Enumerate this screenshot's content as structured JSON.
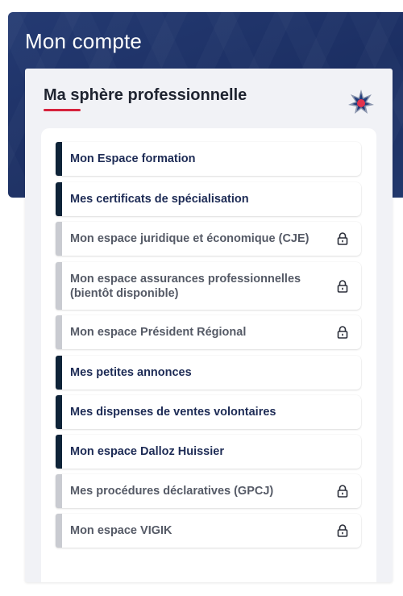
{
  "header": {
    "title": "Mon compte"
  },
  "card": {
    "title": "Ma sphère professionnelle",
    "emblem_icon": "compass-star-emblem",
    "accent_color": "#d6223c"
  },
  "items": [
    {
      "label": "Mon Espace formation",
      "locked": false
    },
    {
      "label": "Mes certificats de spécialisation",
      "locked": false
    },
    {
      "label": "Mon espace juridique et économique (CJE)",
      "locked": true
    },
    {
      "label": "Mon espace assurances professionnelles (bientôt disponible)",
      "locked": true
    },
    {
      "label": "Mon espace Président Régional",
      "locked": true
    },
    {
      "label": "Mes petites annonces",
      "locked": false
    },
    {
      "label": "Mes dispenses de ventes volontaires",
      "locked": false
    },
    {
      "label": "Mon espace Dalloz Huissier",
      "locked": false
    },
    {
      "label": "Mes procédures déclaratives (GPCJ)",
      "locked": true
    },
    {
      "label": "Mon espace VIGIK",
      "locked": true
    }
  ],
  "colors": {
    "header_bg": "#1c2f63",
    "active_bar": "#0e2338",
    "locked_bar": "#c9cbd1",
    "active_text": "#1d2b55",
    "locked_text": "#555a66"
  }
}
